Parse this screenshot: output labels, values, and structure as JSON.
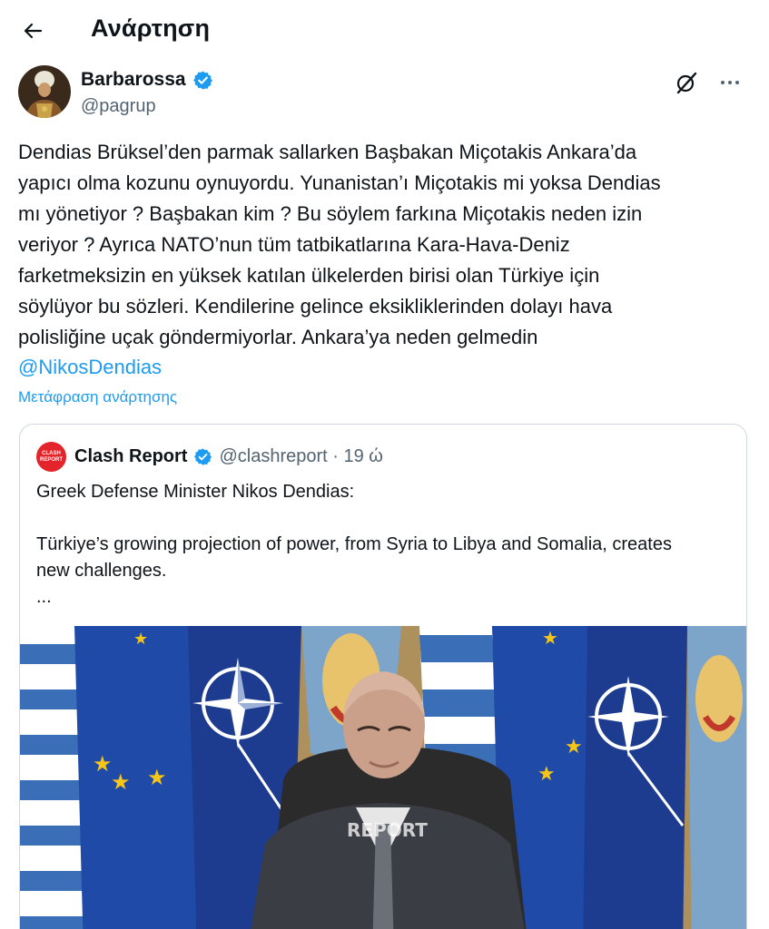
{
  "header": {
    "back_icon": "arrow-left-icon",
    "title": "Ανάρτηση"
  },
  "author": {
    "name": "Barbarossa",
    "handle": "@pagrup",
    "verified": true,
    "badge_color": "#1d9bf0"
  },
  "post": {
    "text": "Dendias Brüksel’den parmak sallarken Başbakan Miçotakis Ankara’da\nyapıcı olma kozunu oynuyordu. Yunanistan’ı Miçotakis mi yoksa Dendias\nmı yönetiyor ? Başbakan kim ? Bu söylem farkına Miçotakis neden izin\nveriyor ? Ayrıca NATO’nun tüm tatbikatlarına Kara-Hava-Deniz\nfarketmeksizin en yüksek katılan ülkelerden birisi olan Türkiye için\nsöylüyor bu sözleri. Kendilerine gelince eksikliklerinden dolayı hava\npolisliğine uçak göndermiyorlar. Ankara’ya neden gelmedin",
    "mention": "@NikosDendias",
    "translate_label": "Μετάφραση ανάρτησης"
  },
  "quote": {
    "logo_line1": "CLASH",
    "logo_line2": "REPORT",
    "name": "Clash Report",
    "handle_time": "@clashreport · 19 ώ",
    "text": "Greek Defense Minister Nikos Dendias:\n\nTürkiye’s growing projection of power, from Syria to Libya and Somalia, creates\nnew challenges.\n...",
    "watermark": "REPORT"
  },
  "colors": {
    "accent": "#1d9bf0",
    "secondary_text": "#536471",
    "border": "#cfd9de",
    "brand_red": "#e3242b"
  }
}
